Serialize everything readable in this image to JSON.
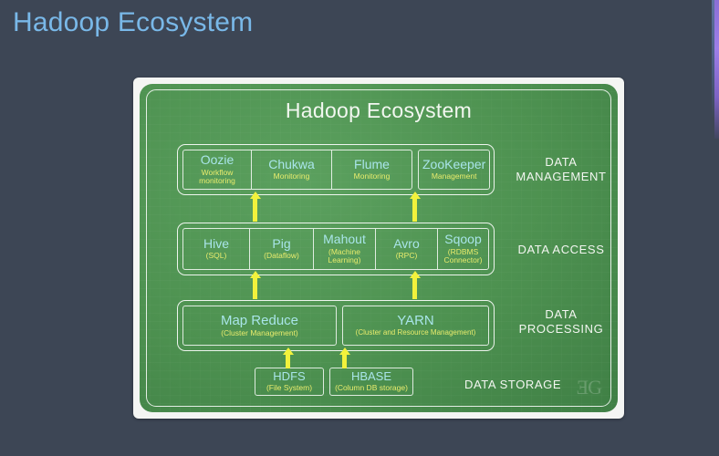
{
  "slide": {
    "title": "Hadoop Ecosystem",
    "background_color": "#3d4655",
    "title_color": "#79b8e8"
  },
  "diagram": {
    "title": "Hadoop Ecosystem",
    "panel_color": "#4d9150",
    "name_color": "#a9e5ea",
    "sub_color": "#e9ec6d",
    "arrow_color": "#f2f23c",
    "watermark": "ƎG",
    "layers": [
      {
        "category": "DATA MANAGEMENT",
        "category_line1": "DATA",
        "category_line2": "MANAGEMENT",
        "components": [
          {
            "name": "Oozie",
            "sub": "Workflow monitoring"
          },
          {
            "name": "Chukwa",
            "sub": "Monitoring"
          },
          {
            "name": "Flume",
            "sub": "Monitoring"
          },
          {
            "name": "ZooKeeper",
            "sub": "Management"
          }
        ]
      },
      {
        "category": "DATA ACCESS",
        "components": [
          {
            "name": "Hive",
            "sub": "(SQL)"
          },
          {
            "name": "Pig",
            "sub": "(Dataflow)"
          },
          {
            "name": "Mahout",
            "sub": "(Machine Learning)"
          },
          {
            "name": "Avro",
            "sub": "(RPC)"
          },
          {
            "name": "Sqoop",
            "sub": "(RDBMS Connector)"
          }
        ]
      },
      {
        "category": "DATA PROCESSING",
        "category_line1": "DATA",
        "category_line2": "PROCESSING",
        "components": [
          {
            "name": "Map Reduce",
            "sub": "(Cluster Management)"
          },
          {
            "name": "YARN",
            "sub": "(Cluster and Resource Management)"
          }
        ]
      },
      {
        "category": "DATA STORAGE",
        "components": [
          {
            "name": "HDFS",
            "sub": "(File System)"
          },
          {
            "name": "HBASE",
            "sub": "(Column DB storage)"
          }
        ]
      }
    ]
  }
}
